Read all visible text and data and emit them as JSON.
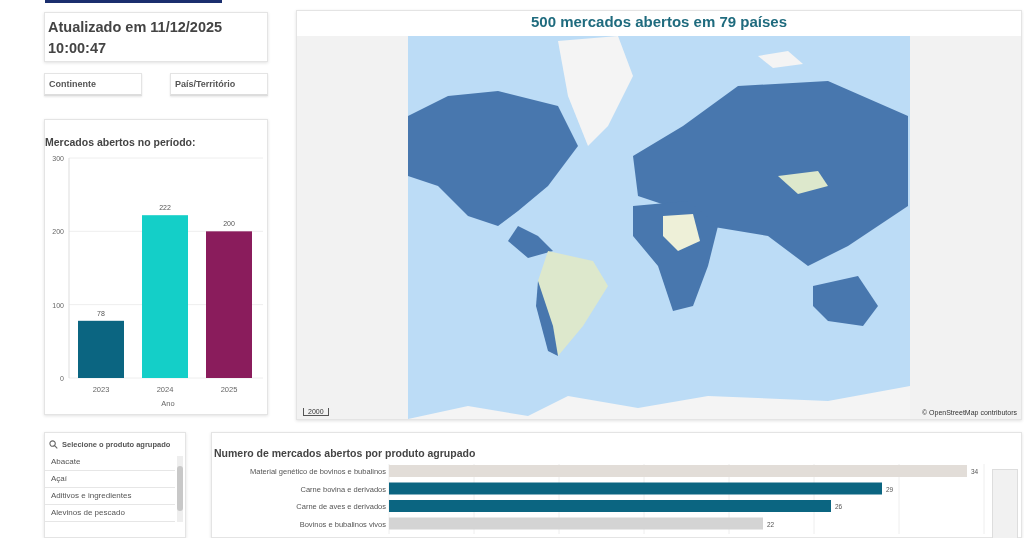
{
  "updated": {
    "text": "Atualizado em 11/12/2025 10:00:47"
  },
  "filters": [
    {
      "label": "Continente"
    },
    {
      "label": "País/Território"
    }
  ],
  "year_chart": {
    "title": "Mercados abertos no período:",
    "bars": [
      {
        "color": "#0b6581"
      },
      {
        "color": "#14cfc8"
      },
      {
        "color": "#8a1c5c"
      }
    ],
    "chart_data": {
      "type": "bar",
      "xlabel": "Ano",
      "categories": [
        "2023",
        "2024",
        "2025"
      ],
      "values": [
        78,
        222,
        200
      ],
      "ylim": [
        0,
        300
      ],
      "yticks": [
        0,
        100,
        200,
        300
      ],
      "data_labels": true
    }
  },
  "map": {
    "title": "500 mercados abertos em 79 países",
    "scale": "2000",
    "attribution": "© OpenStreetMap contributors"
  },
  "product_list": {
    "placeholder": "Selecione o produto agrupado",
    "items": [
      "Abacate",
      "Açaí",
      "Aditivos e ingredientes",
      "Alevinos de pescado"
    ]
  },
  "product_chart": {
    "title": "Numero de mercados abertos por produto agrupado",
    "bars": [
      {
        "color": "#e2ddd8"
      },
      {
        "color": "#0b6581"
      },
      {
        "color": "#0b6581"
      },
      {
        "color": "#d4d4d4"
      }
    ],
    "chart_data": {
      "type": "bar",
      "orientation": "horizontal",
      "categories": [
        "Material genético de bovinos e bubalinos",
        "Carne bovina e derivados",
        "Carne de aves e derivados",
        "Bovinos e bubalinos vivos"
      ],
      "values": [
        34,
        29,
        26,
        22
      ],
      "data_labels": true
    }
  }
}
